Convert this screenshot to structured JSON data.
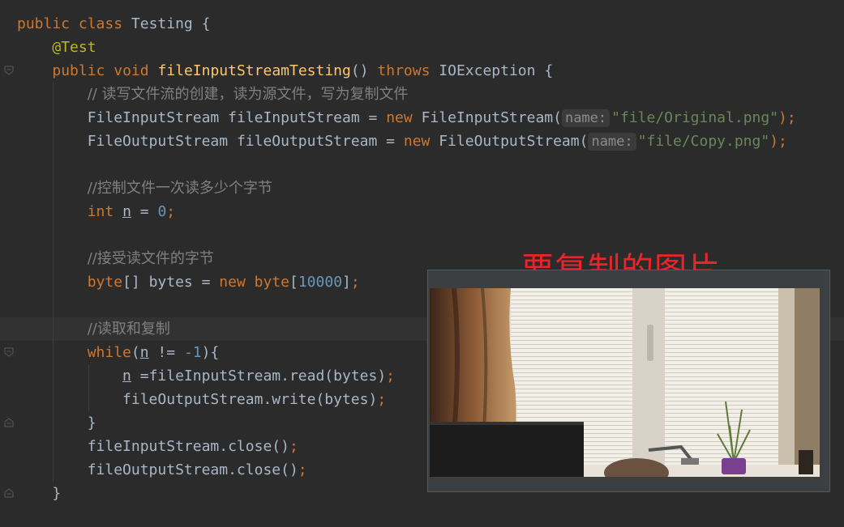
{
  "code": {
    "class_decl": {
      "kw1": "public",
      "kw2": "class",
      "name": "Testing",
      "brace": "{"
    },
    "annotation": "@Test",
    "method_decl": {
      "kw1": "public",
      "kw2": "void",
      "name": "fileInputStreamTesting",
      "parens": "()",
      "throws": "throws",
      "exc": "IOException",
      "brace": "{"
    },
    "comment1": "// 读写文件流的创建，读为源文件，写为复制文件",
    "line_fis": {
      "type": "FileInputStream",
      "var": "fileInputStream",
      "eq": "=",
      "new": "new",
      "ctor": "FileInputStream(",
      "hint": "name:",
      "str": "\"file/Original.png\"",
      "end": ");"
    },
    "line_fos": {
      "type": "FileOutputStream",
      "var": "fileOutputStream",
      "eq": "=",
      "new": "new",
      "ctor": "FileOutputStream(",
      "hint": "name:",
      "str": "\"file/Copy.png\"",
      "end": ");"
    },
    "comment2": "//控制文件一次读多少个字节",
    "line_int": {
      "kw": "int",
      "var": "n",
      "eq": "=",
      "num": "0",
      "end": ";"
    },
    "comment3": "//接受读文件的字节",
    "line_byte": {
      "kw1": "byte",
      "arr": "[] bytes =",
      "new": "new",
      "kw2": "byte",
      "open": "[",
      "num": "10000",
      "close": "]",
      "end": ";"
    },
    "comment4": "//读取和复制",
    "line_while": {
      "kw": "while",
      "open": "(",
      "var": "n",
      "op": " != ",
      "num": "-1",
      "close": "){"
    },
    "line_read": {
      "var": "n",
      "rest": " =fileInputStream.read(bytes)",
      "end": ";"
    },
    "line_write": {
      "text": "fileOutputStream.write(bytes)",
      "end": ";"
    },
    "close_brace": "}",
    "line_close1": {
      "text": "fileInputStream.close()",
      "end": ";"
    },
    "line_close2": {
      "text": "fileOutputStream.close()",
      "end": ";"
    },
    "method_close": "}"
  },
  "overlay": {
    "title": "要复制的图片",
    "title_color": "#e8262a"
  },
  "colors": {
    "background": "#2b2b2b",
    "keyword": "#cc7832",
    "string": "#6a8759",
    "number": "#6897bb",
    "comment": "#808080",
    "method": "#ffc66d",
    "annotation": "#bbb529"
  }
}
